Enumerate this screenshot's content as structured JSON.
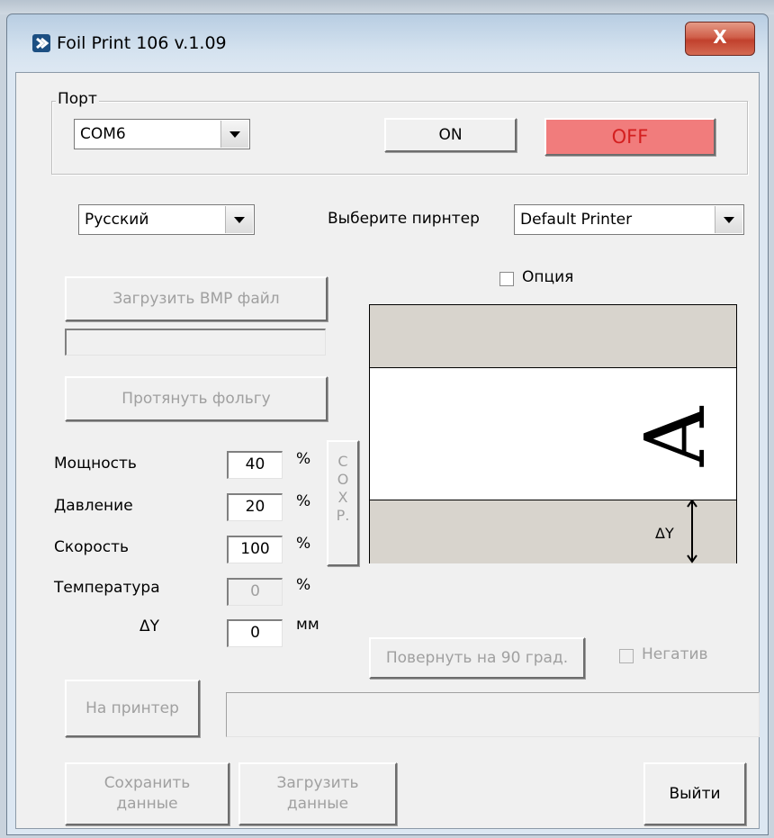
{
  "window": {
    "title": "Foil Print 106 v.1.09",
    "close_label": "X"
  },
  "port_group": {
    "label": "Порт",
    "port_value": "COM6",
    "on_label": "ON",
    "off_label": "OFF",
    "off_color": "#f17c7c"
  },
  "language": {
    "value": "Русский"
  },
  "printer": {
    "label": "Выберите пирнтер",
    "value": "Default Printer"
  },
  "option_label": "Опция",
  "load_bmp_label": "Загрузить BMP файл",
  "pull_foil_label": "Протянуть фольгу",
  "params": [
    {
      "label": "Мощность",
      "value": "40",
      "unit": "%"
    },
    {
      "label": "Давление",
      "value": "20",
      "unit": "%"
    },
    {
      "label": "Скорость",
      "value": "100",
      "unit": "%"
    },
    {
      "label": "Температура",
      "value": "0",
      "unit": "%"
    },
    {
      "label": "ΔY",
      "value": "0",
      "unit": "мм"
    }
  ],
  "save_vertical": [
    "С",
    "О",
    "Х",
    "Р."
  ],
  "preview": {
    "glyph": "A",
    "delta_label": "ΔY"
  },
  "rotate_label": "Повернуть на 90 град.",
  "negative_label": "Негатив",
  "to_printer_label": "На принтер",
  "save_data_label": [
    "Сохранить",
    "данные"
  ],
  "load_data_label": [
    "Загрузить",
    "данные"
  ],
  "exit_label": "Выйти"
}
